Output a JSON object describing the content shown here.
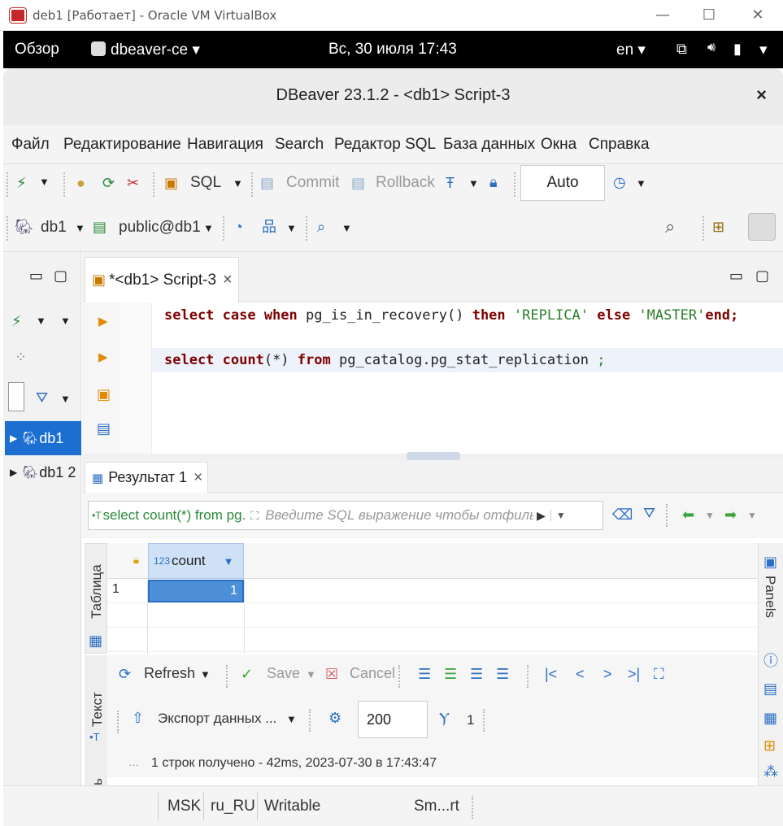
{
  "vbox": {
    "title": "deb1 [Работает] - Oracle VM VirtualBox",
    "minimize": "—",
    "maximize": "☐",
    "close": "✕"
  },
  "gnome": {
    "overview": "Обзор",
    "app_name": "dbeaver-ce ▾",
    "clock": "Вс, 30 июля  17:43",
    "lang": "en ▾",
    "tray": "▾"
  },
  "window": {
    "title": "DBeaver 23.1.2 - <db1> Script-3",
    "close": "×"
  },
  "menu": [
    "Файл",
    "Редактирование",
    "Навигация",
    "Search",
    "Редактор SQL",
    "База данных",
    "Окна",
    "Справка"
  ],
  "toolbar1": {
    "sql": "SQL",
    "commit": "Commit",
    "rollback": "Rollback",
    "transaction_mode": "Auto"
  },
  "toolbar2": {
    "datasource": "db1",
    "schema": "public@db1"
  },
  "navigator": {
    "items": [
      {
        "label": "db1"
      },
      {
        "label": "db1 2"
      }
    ]
  },
  "editor": {
    "tab_label": "*<db1> Script-3",
    "tab_close": "×",
    "lines": [
      {
        "tokens": [
          {
            "t": "select case when ",
            "c": "kw"
          },
          {
            "t": "pg_is_in_recovery() ",
            "c": "fn"
          },
          {
            "t": "then ",
            "c": "kw"
          },
          {
            "t": "'REPLICA' ",
            "c": "str"
          },
          {
            "t": "else ",
            "c": "kw"
          },
          {
            "t": "'MASTER'",
            "c": "str"
          },
          {
            "t": "end;",
            "c": "kw"
          }
        ]
      },
      {
        "tokens": [
          {
            "t": "select count",
            "c": "kw"
          },
          {
            "t": "(*) ",
            "c": "fn"
          },
          {
            "t": "from ",
            "c": "kw"
          },
          {
            "t": "pg_catalog.pg_stat_replication ",
            "c": "fn"
          },
          {
            "t": ";",
            "c": "str"
          }
        ]
      }
    ]
  },
  "results": {
    "tab_label": "Результат 1",
    "tab_close": "×",
    "query_preview": "select count(*) from pg.",
    "filter_placeholder": "Введите SQL выражение чтобы отфильтр",
    "side_tab_table": "Таблица",
    "side_tab_text": "Текст",
    "side_tab_extra": "ь",
    "panels_label": "Panels",
    "column_type": "123",
    "column_name": "count",
    "rows": [
      {
        "num": "1",
        "count": "1"
      }
    ],
    "refresh": "Refresh",
    "save": "Save",
    "cancel": "Cancel",
    "export": "Экспорт данных ...",
    "max_rows": "200",
    "fetched_count": "1",
    "status": "1 строк получено - 42ms, 2023-07-30 в 17:43:47"
  },
  "statusbar": {
    "timezone": "MSK",
    "locale": "ru_RU",
    "mode": "Writable",
    "insert_mode": "Sm...rt"
  },
  "colors": {
    "keyword": "#7f0000",
    "string": "#2a7d2a",
    "selection": "#1c6fd1",
    "accent_green": "#3aa33a",
    "accent_blue": "#2b6fc2"
  }
}
